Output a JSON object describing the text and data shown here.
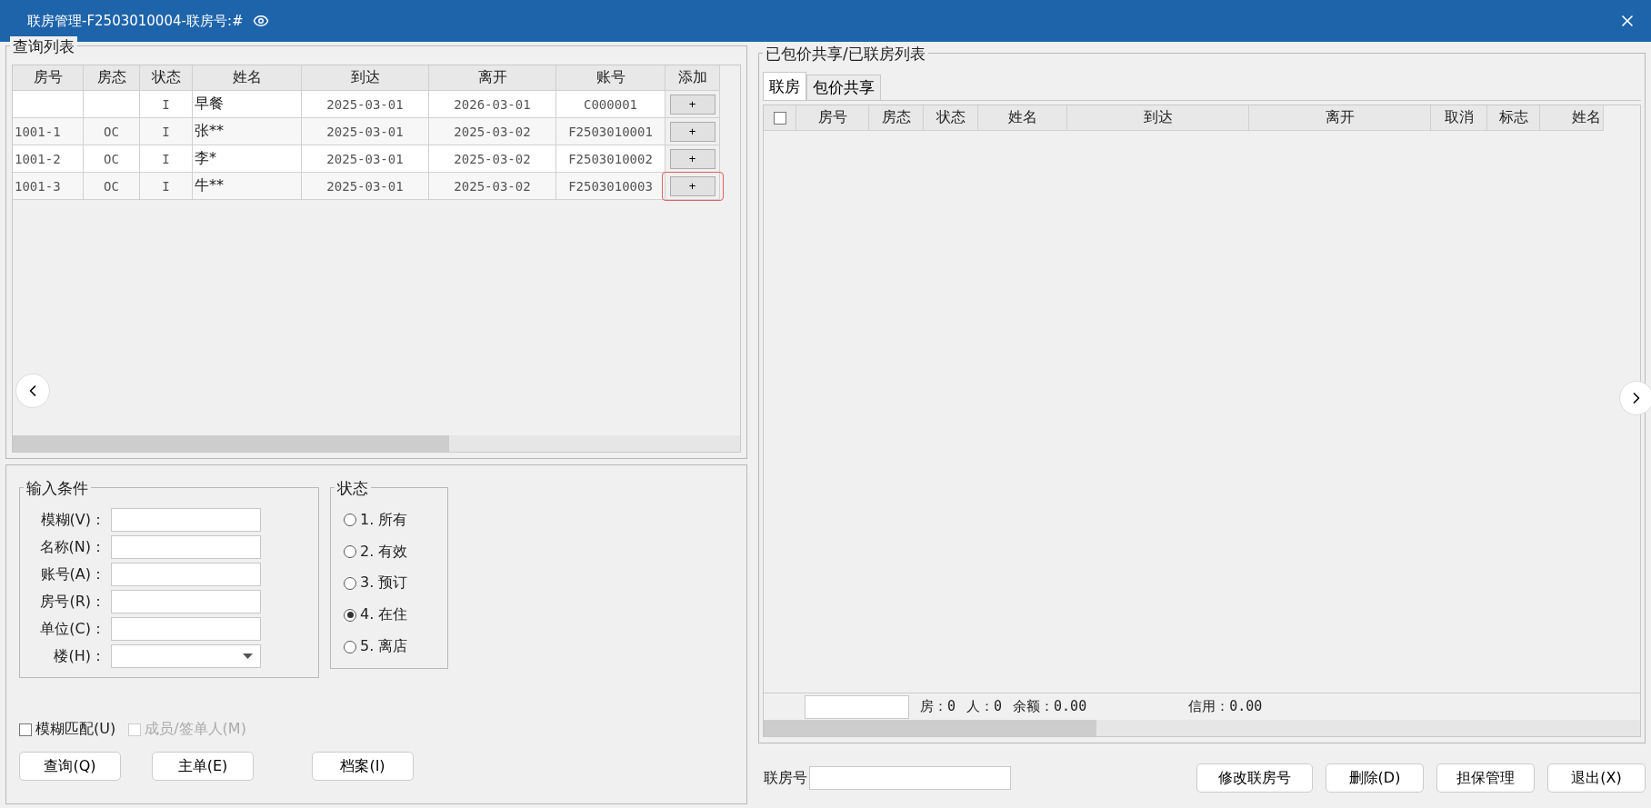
{
  "window": {
    "title": "联房管理-F2503010004-联房号:#"
  },
  "query_list": {
    "title": "查询列表",
    "columns": [
      "房号",
      "房态",
      "状态",
      "姓名",
      "到达",
      "离开",
      "账号",
      "添加"
    ],
    "rows": [
      {
        "cells": [
          "",
          "",
          "I",
          "早餐",
          "2025-03-01",
          "2026-03-01",
          "C000001"
        ],
        "add": "+",
        "highlighted": false
      },
      {
        "cells": [
          "1001-1",
          "OC",
          "I",
          "张**",
          "2025-03-01",
          "2025-03-02",
          "F2503010001"
        ],
        "add": "+",
        "highlighted": false
      },
      {
        "cells": [
          "1001-2",
          "OC",
          "I",
          "李*",
          "2025-03-01",
          "2025-03-02",
          "F2503010002"
        ],
        "add": "+",
        "highlighted": false
      },
      {
        "cells": [
          "1001-3",
          "OC",
          "I",
          "牛**",
          "2025-03-01",
          "2025-03-02",
          "F2503010003"
        ],
        "add": "+",
        "highlighted": true
      }
    ]
  },
  "conditions": {
    "title": "输入条件",
    "fields": [
      {
        "label": "模糊(V)：",
        "kind": "text"
      },
      {
        "label": "名称(N)：",
        "kind": "text"
      },
      {
        "label": "账号(A)：",
        "kind": "text"
      },
      {
        "label": "房号(R)：",
        "kind": "text"
      },
      {
        "label": "单位(C)：",
        "kind": "text"
      },
      {
        "label": "楼(H)：",
        "kind": "dropdown"
      }
    ]
  },
  "status": {
    "title": "状态",
    "options": [
      {
        "label": "1. 所有",
        "selected": false
      },
      {
        "label": "2. 有效",
        "selected": false
      },
      {
        "label": "3. 预订",
        "selected": false
      },
      {
        "label": "4. 在住",
        "selected": true
      },
      {
        "label": "5. 离店",
        "selected": false
      }
    ]
  },
  "checkboxes": [
    {
      "label": "模糊匹配(U)",
      "checked": false,
      "disabled": false
    },
    {
      "label": "成员/签单人(M)",
      "checked": false,
      "disabled": true
    }
  ],
  "left_buttons": [
    "查询(Q)",
    "主单(E)",
    "档案(I)"
  ],
  "linked_list": {
    "title": "已包价共享/已联房列表",
    "tabs": [
      {
        "label": "联房",
        "selected": true
      },
      {
        "label": "包价共享",
        "selected": false
      }
    ],
    "columns": [
      "房号",
      "房态",
      "状态",
      "姓名",
      "到达",
      "离开",
      "取消",
      "标志",
      "姓名"
    ],
    "header_checked": false,
    "footer": [
      "房：0",
      "人：0",
      "余额：0.00",
      "信用：0.00"
    ]
  },
  "bottom": {
    "label": "联房号",
    "buttons": [
      "修改联房号",
      "删除(D)",
      "担保管理",
      "退出(X)"
    ]
  }
}
